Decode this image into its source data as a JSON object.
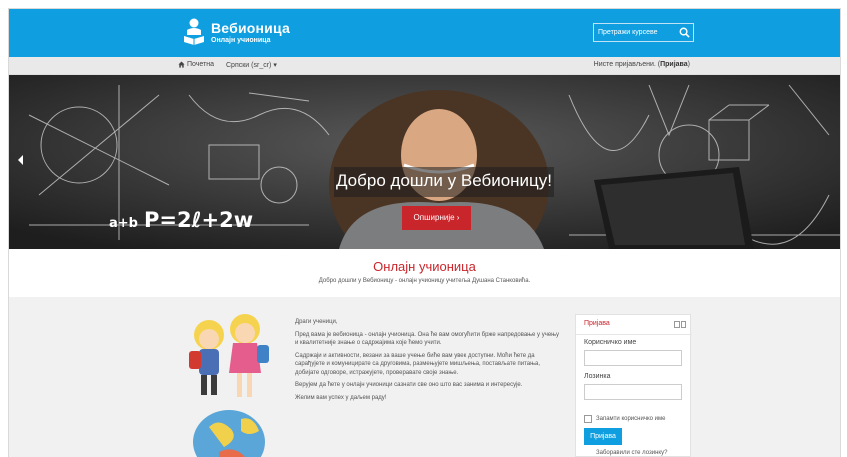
{
  "header": {
    "logo_title": "Вебионица",
    "logo_subtitle": "Онлајн учионица",
    "search_placeholder": "Претражи курсеве",
    "icons": {
      "logo": "student-reading-icon",
      "search": "search-icon"
    },
    "colors": {
      "brand": "#0f9fe0",
      "accent": "#c9262c"
    }
  },
  "nav": {
    "home_label": "Почетна",
    "language_label": "Српски (sr_cr)",
    "login_status": "Нисте пријављени.",
    "login_link": "Пријава",
    "icons": {
      "home": "home-icon",
      "language_caret": "chevron-down-icon"
    }
  },
  "hero": {
    "title": "Добро дошли у Вебионицу!",
    "button_label": "Опширније ›",
    "chalk_formula": "P=2ℓ+2w",
    "chalk_prefix": "a+b",
    "icons": {
      "prev": "chevron-left-icon"
    }
  },
  "intro": {
    "title": "Онлајн учионица",
    "subtitle": "Добро дошли у Вебионицу - онлајн учионицу учитеља Душана Станковића."
  },
  "letter": {
    "greeting": "Драги ученици,",
    "p1": "Пред вама је вебионица - онлајн учионица. Она ће вам омогућити брже напредовање у учењу и квалитетније знање о садржајима које ћемо учити.",
    "p2": "Садржаји и активности, везани за ваше учење биће вам увек доступни. Моћи ћете да сарађујете и комуницирате са друговима, размењујете мишљења, постављате питања, добијате одговоре, истражујете, проверавате своје знање.",
    "p3": "Верујем да ћете у онлајн учионици сазнати све оно што вас занима и интересује.",
    "p4": "Желим вам успех у даљем раду!"
  },
  "login_block": {
    "title": "Пријава",
    "username_label": "Корисничко име",
    "password_label": "Лозинка",
    "remember_label": "Запамти корисничко име",
    "button_label": "Пријава",
    "forgot_label": "Заборавили сте лозинку?"
  }
}
